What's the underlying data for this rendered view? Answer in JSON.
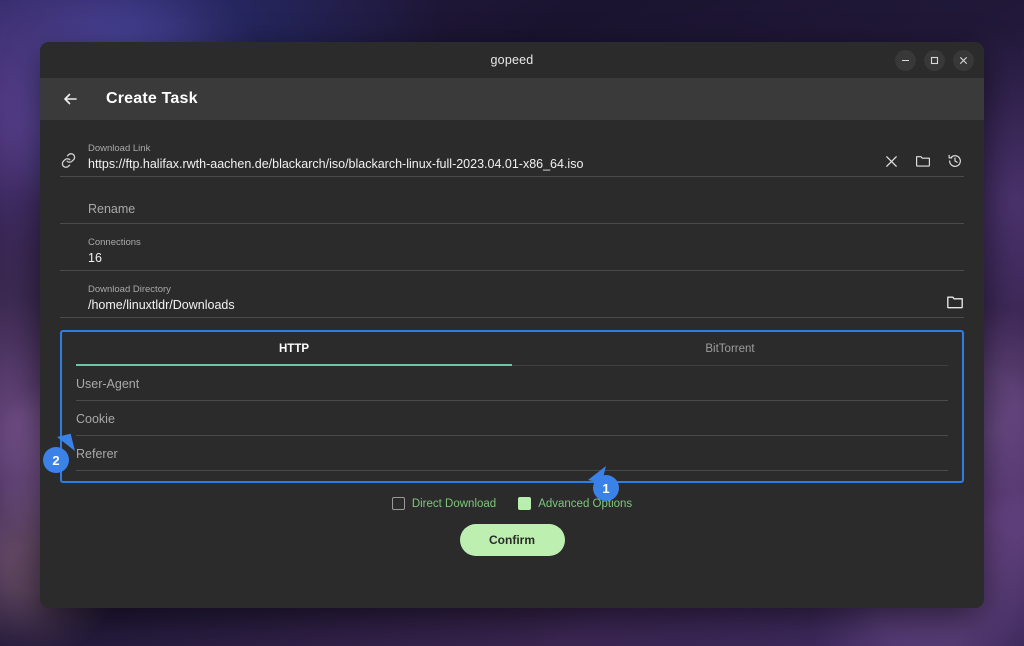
{
  "window": {
    "title": "gopeed",
    "controls": {
      "minimize": "minimize-icon",
      "maximize": "maximize-icon",
      "close": "close-icon"
    }
  },
  "header": {
    "back_icon": "arrow-left-icon",
    "title": "Create Task"
  },
  "form": {
    "download_link": {
      "icon": "link-icon",
      "label": "Download Link",
      "value": "https://ftp.halifax.rwth-aachen.de/blackarch/iso/blackarch-linux-full-2023.04.01-x86_64.iso",
      "actions": [
        "clear-icon",
        "folder-icon",
        "history-icon"
      ]
    },
    "rename": {
      "label": "Rename",
      "value": "",
      "placeholder": "Rename"
    },
    "connections": {
      "label": "Connections",
      "value": "16"
    },
    "download_directory": {
      "label": "Download Directory",
      "value": "/home/linuxtldr/Downloads",
      "action_icon": "folder-icon"
    }
  },
  "advanced": {
    "tabs": [
      {
        "label": "HTTP",
        "active": true
      },
      {
        "label": "BitTorrent",
        "active": false
      }
    ],
    "fields": [
      {
        "label": "User-Agent",
        "value": "",
        "placeholder": "User-Agent"
      },
      {
        "label": "Cookie",
        "value": "",
        "placeholder": "Cookie"
      },
      {
        "label": "Referer",
        "value": "",
        "placeholder": "Referer"
      }
    ],
    "highlight_color": "#2f7de0",
    "active_tab_color": "#69c8a8"
  },
  "options": {
    "direct_download": {
      "label": "Direct Download",
      "checked": false
    },
    "advanced_options": {
      "label": "Advanced Options",
      "checked": true
    },
    "label_color": "#7cc77a"
  },
  "confirm": {
    "label": "Confirm",
    "color": "#bdf0b0"
  },
  "annotations": [
    {
      "number": "1",
      "color": "#3b82e8"
    },
    {
      "number": "2",
      "color": "#3b82e8"
    }
  ]
}
